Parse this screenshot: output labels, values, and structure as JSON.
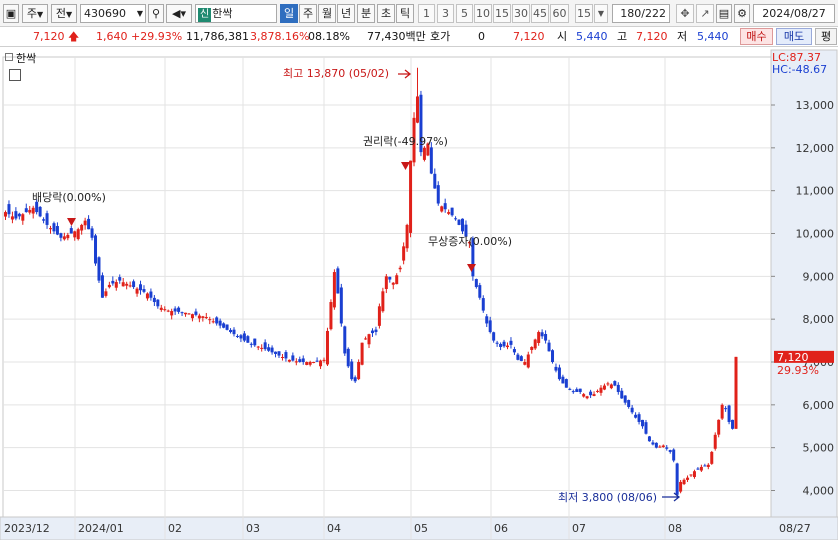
{
  "toolbar": {
    "market": "주",
    "period_type": "전",
    "stock_code": "430690",
    "new_badge": "신",
    "stock_name": "한싹",
    "period_tabs": [
      "일",
      "주",
      "월",
      "년",
      "분",
      "초",
      "틱"
    ],
    "selected_period": "일",
    "interval_buttons": [
      "1",
      "3",
      "5",
      "10",
      "15",
      "30",
      "45",
      "60"
    ],
    "custom_interval": "15",
    "view_count": "180",
    "total_count": "/222",
    "date": "2024/08/27"
  },
  "quote": {
    "price": "7,120",
    "change": "1,640",
    "change_pct": "+29.93%",
    "volume": "11,786,381",
    "volume_ratio": "3,878.16%",
    "turnover": "08.18%",
    "amount": "77,430백만",
    "hoga_label": "호가",
    "hoga_value": "0",
    "hoga_price": "7,120",
    "open_label": "시",
    "open": "5,440",
    "high_label": "고",
    "high": "7,120",
    "low_label": "저",
    "low": "5,440",
    "buy_button": "매수",
    "sell_button": "매도",
    "eval_button": "평"
  },
  "chart": {
    "legend_name": "한싹",
    "lc_label": "LC:87.37",
    "hc_label": "HC:-48.67",
    "current_price_label": "7,120",
    "current_pct_label": "29.93%"
  },
  "chart_data": {
    "type": "candlestick",
    "y_ticks": [
      "13,000",
      "12,000",
      "11,000",
      "10,000",
      "9,000",
      "8,000",
      "7,000",
      "6,000",
      "5,000",
      "4,000"
    ],
    "y_tick_values": [
      13000,
      12000,
      11000,
      10000,
      9000,
      8000,
      7000,
      6000,
      5000,
      4000
    ],
    "ylim": [
      3480,
      14700
    ],
    "x_labels": [
      "2023/12",
      "2024/01",
      "02",
      "03",
      "04",
      "05",
      "06",
      "07",
      "08",
      "08/27"
    ],
    "annotations": [
      {
        "text": "최고 13,870 (05/02)",
        "value": 13870,
        "type": "high"
      },
      {
        "text": "권리락(-49.97%)",
        "type": "event"
      },
      {
        "text": "배당락(0.00%)",
        "type": "event"
      },
      {
        "text": "무상증자(0.00%)",
        "type": "event"
      },
      {
        "text": "최저 3,800 (08/06)",
        "value": 3800,
        "type": "low"
      }
    ],
    "anchors": [
      [
        0,
        10500
      ],
      [
        3,
        10350
      ],
      [
        8,
        10600
      ],
      [
        12,
        10200
      ],
      [
        16,
        9900
      ],
      [
        19,
        10000
      ],
      [
        21,
        10100
      ],
      [
        23,
        10300
      ],
      [
        25,
        9900
      ],
      [
        26,
        9300
      ],
      [
        28,
        8500
      ],
      [
        30,
        8800
      ],
      [
        33,
        8900
      ],
      [
        37,
        8750
      ],
      [
        41,
        8600
      ],
      [
        44,
        8300
      ],
      [
        47,
        8200
      ],
      [
        52,
        8150
      ],
      [
        58,
        8050
      ],
      [
        62,
        7850
      ],
      [
        66,
        7650
      ],
      [
        70,
        7450
      ],
      [
        75,
        7300
      ],
      [
        79,
        7150
      ],
      [
        82,
        7050
      ],
      [
        85,
        7000
      ],
      [
        89,
        7000
      ],
      [
        92,
        7050
      ],
      [
        94,
        8400
      ],
      [
        95,
        9100
      ],
      [
        96,
        8600
      ],
      [
        98,
        7200
      ],
      [
        100,
        6600
      ],
      [
        101,
        6550
      ],
      [
        103,
        7450
      ],
      [
        105,
        7650
      ],
      [
        107,
        7700
      ],
      [
        108,
        8300
      ],
      [
        110,
        9000
      ],
      [
        112,
        8850
      ],
      [
        114,
        9200
      ],
      [
        116,
        10200
      ],
      [
        117,
        11700
      ],
      [
        118,
        12700
      ],
      [
        119,
        13200
      ],
      [
        120,
        11900
      ],
      [
        122,
        12100
      ],
      [
        123,
        11400
      ],
      [
        125,
        10700
      ],
      [
        128,
        10500
      ],
      [
        130,
        10350
      ],
      [
        132,
        10050
      ],
      [
        134,
        9800
      ],
      [
        135,
        9000
      ],
      [
        137,
        8500
      ],
      [
        139,
        7900
      ],
      [
        141,
        7500
      ],
      [
        143,
        7350
      ],
      [
        146,
        7400
      ],
      [
        148,
        7050
      ],
      [
        150,
        7000
      ],
      [
        152,
        7350
      ],
      [
        154,
        7700
      ],
      [
        156,
        7500
      ],
      [
        158,
        7000
      ],
      [
        160,
        6600
      ],
      [
        162,
        6400
      ],
      [
        164,
        6300
      ],
      [
        166,
        6300
      ],
      [
        168,
        6200
      ],
      [
        170,
        6250
      ],
      [
        172,
        6400
      ],
      [
        174,
        6500
      ],
      [
        176,
        6450
      ],
      [
        177,
        6300
      ],
      [
        178,
        6150
      ],
      [
        180,
        5950
      ],
      [
        182,
        5700
      ],
      [
        184,
        5500
      ],
      [
        186,
        5150
      ],
      [
        188,
        5000
      ],
      [
        190,
        5050
      ],
      [
        192,
        4900
      ],
      [
        193,
        4700
      ],
      [
        194,
        3900
      ],
      [
        195,
        4200
      ],
      [
        197,
        4300
      ],
      [
        199,
        4450
      ],
      [
        201,
        4550
      ],
      [
        203,
        4600
      ],
      [
        204,
        4900
      ],
      [
        205,
        5300
      ],
      [
        206,
        5650
      ],
      [
        207,
        6000
      ],
      [
        208,
        5900
      ],
      [
        209,
        5600
      ],
      [
        210,
        5440
      ],
      [
        211,
        7120
      ]
    ]
  }
}
